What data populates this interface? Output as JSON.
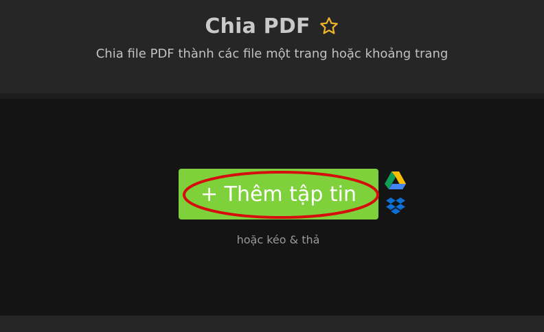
{
  "header": {
    "title": "Chia PDF",
    "favorite_icon": "star-outline-icon",
    "subtitle": "Chia file PDF thành các file một trang hoặc khoảng trang"
  },
  "upload": {
    "button_label": "+ Thêm tập tin",
    "drag_hint": "hoặc kéo & thả",
    "cloud_sources": [
      {
        "name": "Google Drive",
        "icon": "google-drive-icon"
      },
      {
        "name": "Dropbox",
        "icon": "dropbox-icon"
      }
    ]
  },
  "colors": {
    "header_bg": "#262626",
    "body_bg": "#141414",
    "button_green": "#7ed13b",
    "star_gold": "#f0b429",
    "annotation_red": "#d40d0d",
    "dropbox_blue": "#0d6fd6"
  }
}
